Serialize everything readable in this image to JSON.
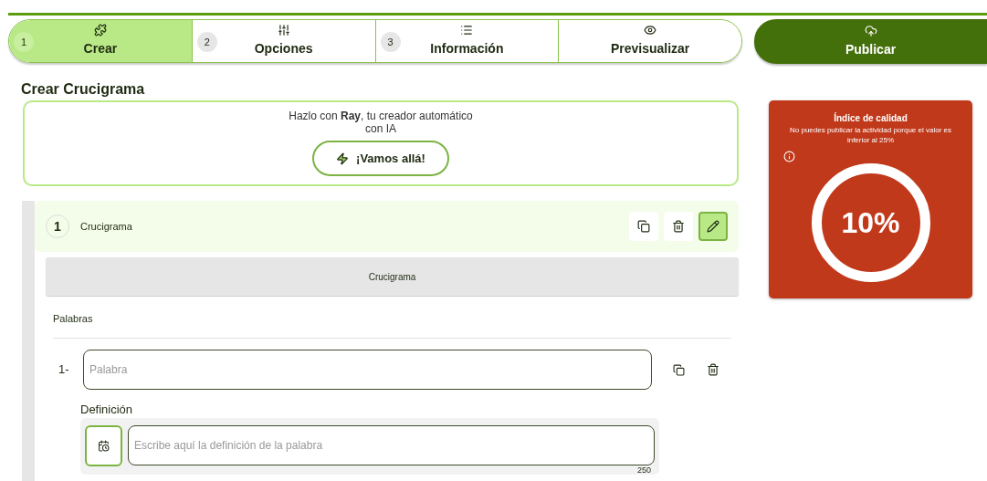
{
  "steps": [
    {
      "number": "1",
      "label": "Crear",
      "kind": "create",
      "selected": true
    },
    {
      "number": "2",
      "label": "Opciones",
      "kind": "options",
      "selected": false
    },
    {
      "number": "3",
      "label": "Información",
      "kind": "info",
      "selected": false
    },
    {
      "label": "Previsualizar",
      "kind": "preview",
      "selected": false
    }
  ],
  "publish_button": "Publicar",
  "page_title": "Crear Crucigrama",
  "ray_card": {
    "text": "Hazlo con **Ray**, tu creador automático con IA",
    "button": "¡Vamos allá!"
  },
  "section": {
    "number": "1",
    "title": "Crucigrama",
    "edit_selected": true,
    "banner": "Crucigrama",
    "words_label": "Palabras",
    "words": [
      {
        "number": "1-",
        "placeholder": "Palabra",
        "definition_label": "Definición",
        "definition_placeholder": "Escribe aquí la definición de la palabra",
        "char_limit": "250"
      }
    ]
  },
  "quality": {
    "title": "Índice de calidad",
    "message": "No puedes publicar la actividad porque el valor es inferior al 25%",
    "value": "10%",
    "passing": false
  }
}
